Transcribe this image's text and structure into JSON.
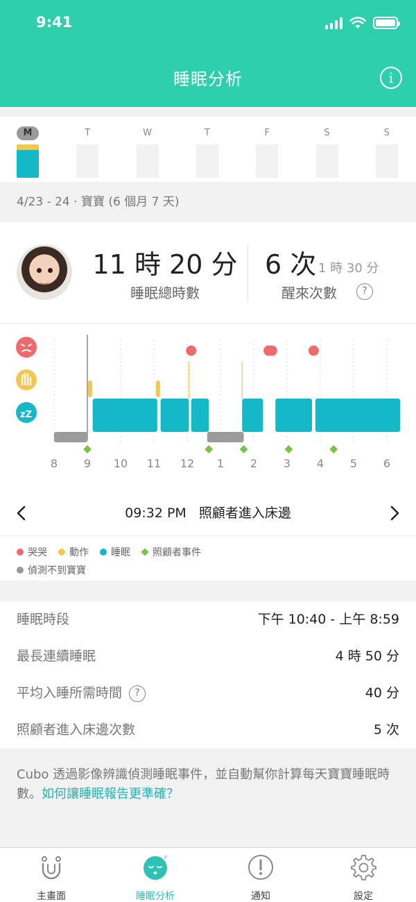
{
  "status_bar": {
    "time": "9:41"
  },
  "header": {
    "title": "睡眠分析"
  },
  "week": [
    {
      "letter": "M",
      "active": true
    },
    {
      "letter": "T",
      "active": false
    },
    {
      "letter": "W",
      "active": false
    },
    {
      "letter": "T",
      "active": false
    },
    {
      "letter": "F",
      "active": false
    },
    {
      "letter": "S",
      "active": false
    },
    {
      "letter": "S",
      "active": false
    }
  ],
  "date_line": "4/23 - 24 · 寶寶 (6 個月 7 天)",
  "summary": {
    "total_value": "11 時 20 分",
    "total_label": "睡眠總時數",
    "wake_value": "6 次",
    "wake_sub": "1 時 30 分",
    "wake_label": "醒來次數"
  },
  "timeline": {
    "hour_labels": [
      "8",
      "9",
      "10",
      "11",
      "12",
      "1",
      "2",
      "3",
      "4",
      "5",
      "6"
    ],
    "colors": {
      "cry": "#ef6b6b",
      "motion": "#f2c650",
      "sleep": "#15b8c6",
      "caregiver": "#7cc24a",
      "undetected": "#9b9b9b"
    },
    "axis_start_hour": 8,
    "sleep_segments": [
      [
        9.16,
        11.1
      ],
      [
        11.2,
        12.05
      ],
      [
        12.12,
        12.65
      ],
      [
        13.65,
        14.28
      ],
      [
        14.65,
        15.75
      ],
      [
        15.85,
        18.4
      ]
    ],
    "undetected_segments": [
      [
        8.0,
        9.0
      ],
      [
        12.6,
        13.7
      ]
    ],
    "cry_events": [
      12.12,
      14.45,
      14.55,
      15.8
    ],
    "motion_events": [
      9.08,
      11.12
    ],
    "caregiver_events": [
      9.0,
      12.65,
      13.7,
      15.05,
      16.4
    ],
    "marker_lines": [
      9.0,
      12.05,
      13.65
    ],
    "current_event_hour": 9.0
  },
  "event_nav": {
    "time": "09:32 PM",
    "label": "照顧者進入床邊"
  },
  "legend": {
    "cry": "哭哭",
    "motion": "動作",
    "sleep": "睡眠",
    "caregiver": "照顧者事件",
    "undetected": "偵測不到寶寶"
  },
  "details": [
    {
      "label": "睡眠時段",
      "value": "下午 10:40 - 上午 8:59"
    },
    {
      "label": "最長連續睡眠",
      "value": "4 時 50 分"
    },
    {
      "label": "平均入睡所需時間",
      "value": "40 分"
    },
    {
      "label": "照顧者進入床邊次數",
      "value": "5 次"
    }
  ],
  "footer": {
    "text": "Cubo 透過影像辨識偵測睡眠事件，並自動幫你計算每天寶寶睡眠時數。",
    "link": "如何讓睡眠報告更準確？"
  },
  "tabs": [
    {
      "label": "主畫面",
      "icon": "home-icon",
      "active": false
    },
    {
      "label": "睡眠分析",
      "icon": "sleep-face-icon",
      "active": true
    },
    {
      "label": "通知",
      "icon": "alert-icon",
      "active": false
    },
    {
      "label": "設定",
      "icon": "gear-icon",
      "active": false
    }
  ]
}
